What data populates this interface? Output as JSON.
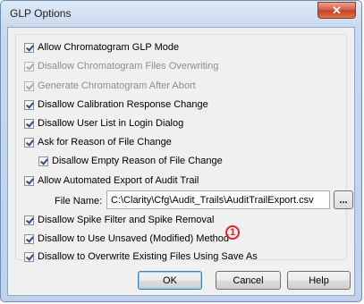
{
  "window": {
    "title": "GLP Options",
    "close_label": "✕"
  },
  "options": [
    {
      "label": "Allow Chromatogram GLP Mode",
      "checked": true,
      "disabled": false
    },
    {
      "label": "Disallow Chromatogram Files Overwriting",
      "checked": true,
      "disabled": true
    },
    {
      "label": "Generate Chromatogram After Abort",
      "checked": true,
      "disabled": true
    },
    {
      "label": "Disallow Calibration Response Change",
      "checked": true,
      "disabled": false
    },
    {
      "label": "Disallow User List in Login Dialog",
      "checked": true,
      "disabled": false
    },
    {
      "label": "Ask for Reason of File Change",
      "checked": true,
      "disabled": false
    },
    {
      "label": "Disallow Empty Reason of File Change",
      "checked": true,
      "disabled": false
    },
    {
      "label": "Allow Automated Export of Audit Trail",
      "checked": true,
      "disabled": false
    },
    {
      "label": "Disallow Spike Filter and Spike Removal",
      "checked": true,
      "disabled": false
    },
    {
      "label": "Disallow to Use Unsaved (Modified) Method",
      "checked": true,
      "disabled": false
    },
    {
      "label": "Disallow to Overwrite Existing Files Using Save As",
      "checked": true,
      "disabled": false
    }
  ],
  "file_name": {
    "label": "File Name:",
    "value": "C:\\Clarity\\Cfg\\Audit_Trails\\AuditTrailExport.csv",
    "browse_label": "..."
  },
  "badge": "1",
  "buttons": {
    "ok": "OK",
    "cancel": "Cancel",
    "help": "Help"
  },
  "colors": {
    "badge": "#e0242c",
    "default_button_border": "#3c7fb1"
  }
}
